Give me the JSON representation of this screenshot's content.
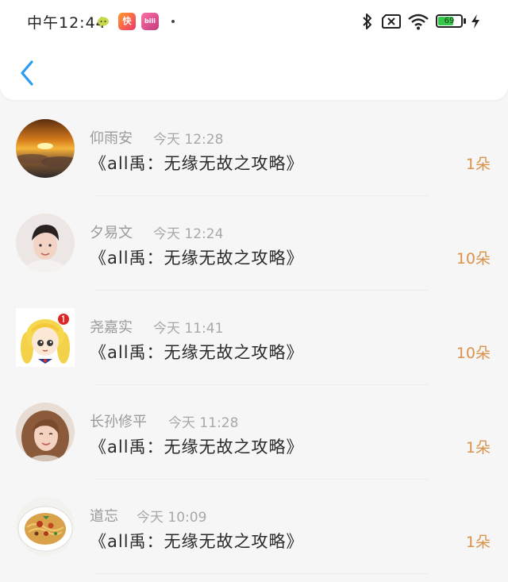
{
  "status_bar": {
    "time": "中午12:44",
    "battery": "69",
    "battery_level": 0.69,
    "icons": [
      "chat-bubble-icon",
      "kuaikan-app-icon",
      "bilibili-app-icon",
      "bluetooth-icon",
      "no-sim-icon",
      "wifi-icon",
      "battery-icon",
      "charging-bolt-icon"
    ],
    "app_badges": {
      "kuaikan": "快",
      "bilibili": "bili"
    }
  },
  "header": {
    "back_icon": "chevron-left-icon",
    "accent_color": "#2b9cf0"
  },
  "items": [
    {
      "name": "仰雨安",
      "time": "今天 12:28",
      "title": "《all禹：无缘无故之攻略》",
      "count": "1朵",
      "avatar": "sunset-clouds-avatar"
    },
    {
      "name": "夕易文",
      "time": "今天 12:24",
      "title": "《all禹：无缘无故之攻略》",
      "count": "10朵",
      "avatar": "young-man-avatar"
    },
    {
      "name": "尧嘉实",
      "time": "今天 11:41",
      "title": "《all禹：无缘无故之攻略》",
      "count": "10朵",
      "avatar": "anime-girl-avatar"
    },
    {
      "name": "长孙修平",
      "time": "今天 11:28",
      "title": "《all禹：无缘无故之攻略》",
      "count": "1朵",
      "avatar": "young-woman-avatar"
    },
    {
      "name": "道忘",
      "time": "今天 10:09",
      "title": "《all禹：无缘无故之攻略》",
      "count": "1朵",
      "avatar": "pasta-dish-avatar"
    }
  ],
  "colors": {
    "count_color": "#d9934a",
    "name_color": "#9a9a9a",
    "title_color": "#2a2a2a",
    "background": "#f6f6f6"
  }
}
